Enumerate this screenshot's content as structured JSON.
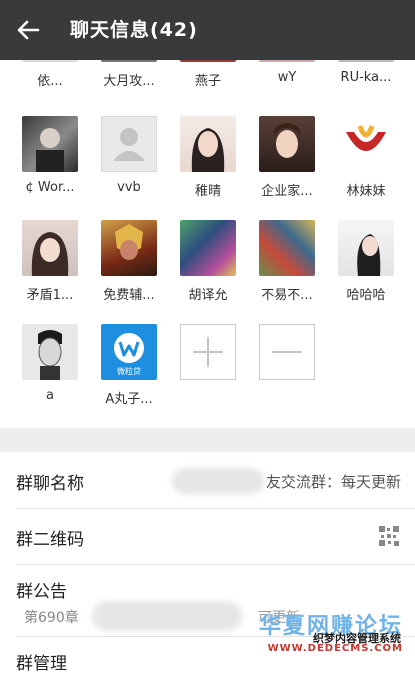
{
  "header": {
    "title": "聊天信息(42)"
  },
  "members_row0": [
    "依...",
    "大月攻...",
    "燕子",
    "wY",
    "RU-ka..."
  ],
  "members": [
    {
      "name": "¢ Wor...",
      "avatar": "dark-portrait"
    },
    {
      "name": "vvb",
      "avatar": "default-person"
    },
    {
      "name": "稚晴",
      "avatar": "girl-portrait"
    },
    {
      "name": "企业家...",
      "avatar": "girl-portrait-2"
    },
    {
      "name": "林妹妹",
      "avatar": "red-y-logo"
    },
    {
      "name": "矛盾1...",
      "avatar": "girl-portrait-3"
    },
    {
      "name": "免费辅...",
      "avatar": "game-hero"
    },
    {
      "name": "胡译允",
      "avatar": "colorful-art"
    },
    {
      "name": "不易不...",
      "avatar": "comic-art"
    },
    {
      "name": "哈哈哈",
      "avatar": "girl-white"
    },
    {
      "name": "a",
      "avatar": "bw-man"
    },
    {
      "name": "A丸子...",
      "avatar": "blue-w-logo",
      "logo_text": "微粒贷"
    }
  ],
  "actions": {
    "add": "+",
    "remove": "−"
  },
  "settings": {
    "group_name_label": "群聊名称",
    "group_name_value": "友交流群：每天更新",
    "qr_label": "群二维码",
    "notice_label": "群公告",
    "notice_preview": "第690章",
    "notice_tail": "可更新",
    "manage_label": "群管理"
  },
  "watermark": {
    "title": "华夏网赚论坛",
    "sub": "织梦内容管理系统",
    "url": "WWW.DEDECMS.COM"
  },
  "colors": {
    "topbar": "#3a3a3c",
    "separator": "#ededed",
    "accent": "#2a86d8"
  }
}
